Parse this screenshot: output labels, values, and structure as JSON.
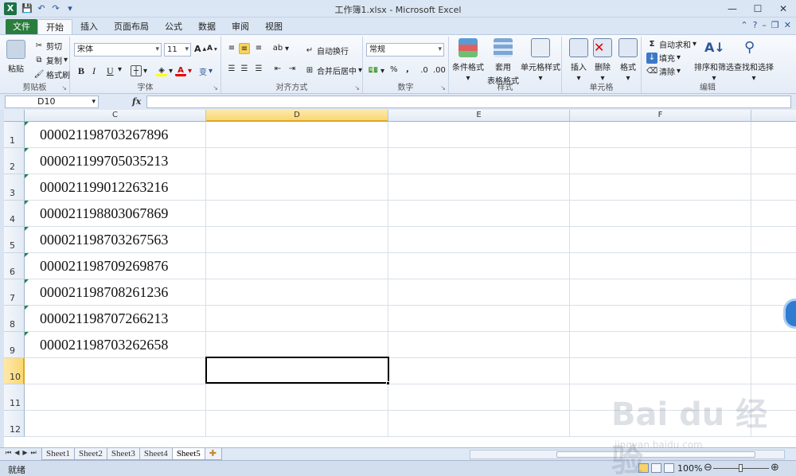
{
  "window": {
    "title": "工作簿1.xlsx - Microsoft Excel",
    "logo": "X"
  },
  "tabs": {
    "file": "文件",
    "items": [
      "开始",
      "插入",
      "页面布局",
      "公式",
      "数据",
      "审阅",
      "视图"
    ],
    "active": "开始"
  },
  "ribbon": {
    "clipboard": {
      "label": "剪贴板",
      "paste": "粘贴",
      "cut": "剪切",
      "copy": "复制",
      "format_painter": "格式刷"
    },
    "font": {
      "label": "字体",
      "name": "宋体",
      "size": "11",
      "bold": "B",
      "italic": "I",
      "underline": "U",
      "grow": "A",
      "shrink": "A",
      "color_a": "A",
      "phonetic": "变"
    },
    "alignment": {
      "label": "对齐方式",
      "wrap": "自动换行",
      "merge": "合并后居中"
    },
    "number": {
      "label": "数字",
      "format": "常规",
      "percent": "%",
      "comma": ","
    },
    "styles": {
      "label": "样式",
      "conditional": "条件格式",
      "table_line1": "套用",
      "table_line2": "表格格式",
      "cell_styles": "单元格样式"
    },
    "cells": {
      "label": "单元格",
      "insert": "插入",
      "delete": "删除",
      "format": "格式"
    },
    "editing": {
      "label": "编辑",
      "autosum": "自动求和",
      "fill": "填充",
      "clear": "清除",
      "sort": "排序和筛选",
      "find": "查找和选择"
    }
  },
  "formula_bar": {
    "name_box": "D10",
    "fx": "fx",
    "value": ""
  },
  "grid": {
    "columns": [
      "C",
      "D",
      "E",
      "F"
    ],
    "selected_column": "D",
    "rows": [
      "1",
      "2",
      "3",
      "4",
      "5",
      "6",
      "7",
      "8",
      "9",
      "10",
      "11",
      "12"
    ],
    "selected_row": "10",
    "column_c_values": [
      "000021198703267896",
      "000021199705035213",
      "000021199012263216",
      "000021198803067869",
      "000021198703267563",
      "000021198709269876",
      "000021198708261236",
      "000021198707266213",
      "000021198703262658"
    ],
    "active_cell": "D10"
  },
  "sheets": {
    "items": [
      "Sheet1",
      "Sheet2",
      "Sheet3",
      "Sheet4",
      "Sheet5"
    ],
    "active": "Sheet5"
  },
  "status": {
    "ready": "就绪",
    "zoom": "100%"
  },
  "watermark": {
    "main": "Bai du 经验",
    "sub": "jingyan.baidu.com"
  },
  "colors": {
    "file_tab": "#2a7d3c",
    "selected_header": "#f9d774",
    "error_triangle": "#1b8a3a"
  }
}
